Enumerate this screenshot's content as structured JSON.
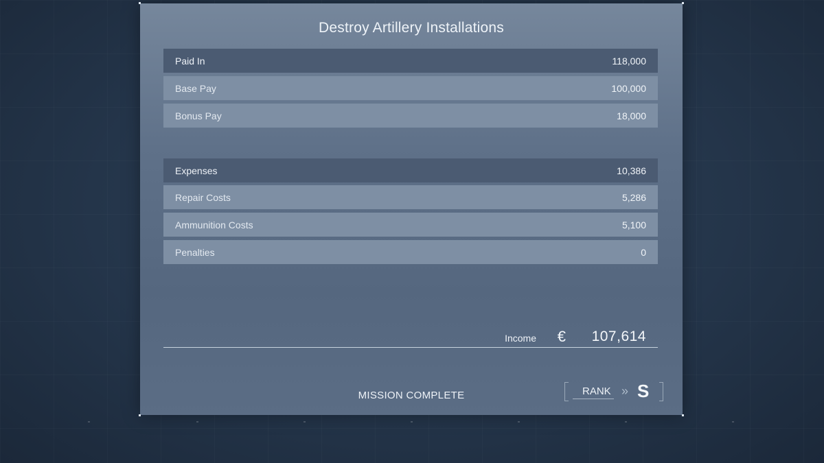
{
  "mission": {
    "title": "Destroy Artillery Installations",
    "status": "MISSION COMPLETE"
  },
  "paid_in": {
    "label": "Paid In",
    "total": "118,000",
    "items": [
      {
        "label": "Base Pay",
        "value": "100,000"
      },
      {
        "label": "Bonus Pay",
        "value": "18,000"
      }
    ]
  },
  "expenses": {
    "label": "Expenses",
    "total": "10,386",
    "items": [
      {
        "label": "Repair Costs",
        "value": "5,286"
      },
      {
        "label": "Ammunition Costs",
        "value": "5,100"
      },
      {
        "label": "Penalties",
        "value": "0"
      }
    ]
  },
  "income": {
    "label": "Income",
    "currency_symbol": "€",
    "value": "107,614"
  },
  "rank": {
    "label": "RANK",
    "arrows": "»",
    "grade": "S"
  },
  "colors": {
    "panel": "#5f7189",
    "header_row": "#4b5b72",
    "item_row": "#7e8fa4",
    "background": "#24354a"
  }
}
